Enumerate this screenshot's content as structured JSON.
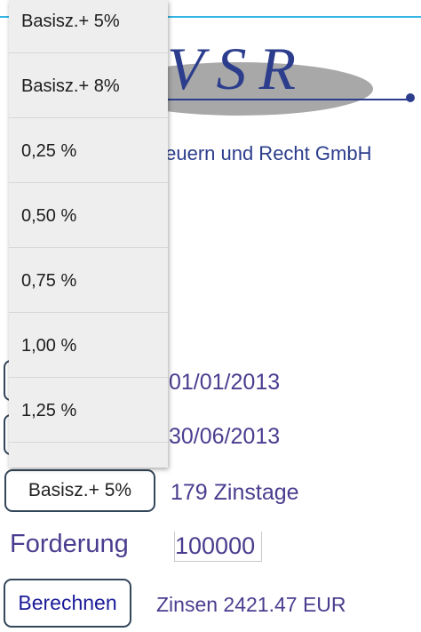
{
  "logo": {
    "letters": "VSR",
    "company_text": "teuern und Recht GmbH",
    "ellipse_color": "#a8a8a8",
    "letter_color": "#2b3d8c"
  },
  "form": {
    "start_date": "01/01/2013",
    "end_date": "30/06/2013",
    "rate_button_label": "Basisz.+ 5%",
    "days_text": "179 Zinstage",
    "claim_label": "Forderung",
    "claim_value": "100000",
    "calculate_label": "Berechnen",
    "result_text": "Zinsen 2421.47 EUR"
  },
  "dropdown": {
    "items": [
      {
        "label": "Basisz.+ 5%"
      },
      {
        "label": "Basisz.+ 8%"
      },
      {
        "label": "0,25 %"
      },
      {
        "label": "0,50 %"
      },
      {
        "label": "0,75 %"
      },
      {
        "label": "1,00 %"
      },
      {
        "label": "1,25 %"
      }
    ]
  },
  "colors": {
    "accent_line": "#33b5e5",
    "text_purple": "#4a3d8f",
    "button_border": "#33465a",
    "dropdown_bg": "#eeeeee"
  }
}
